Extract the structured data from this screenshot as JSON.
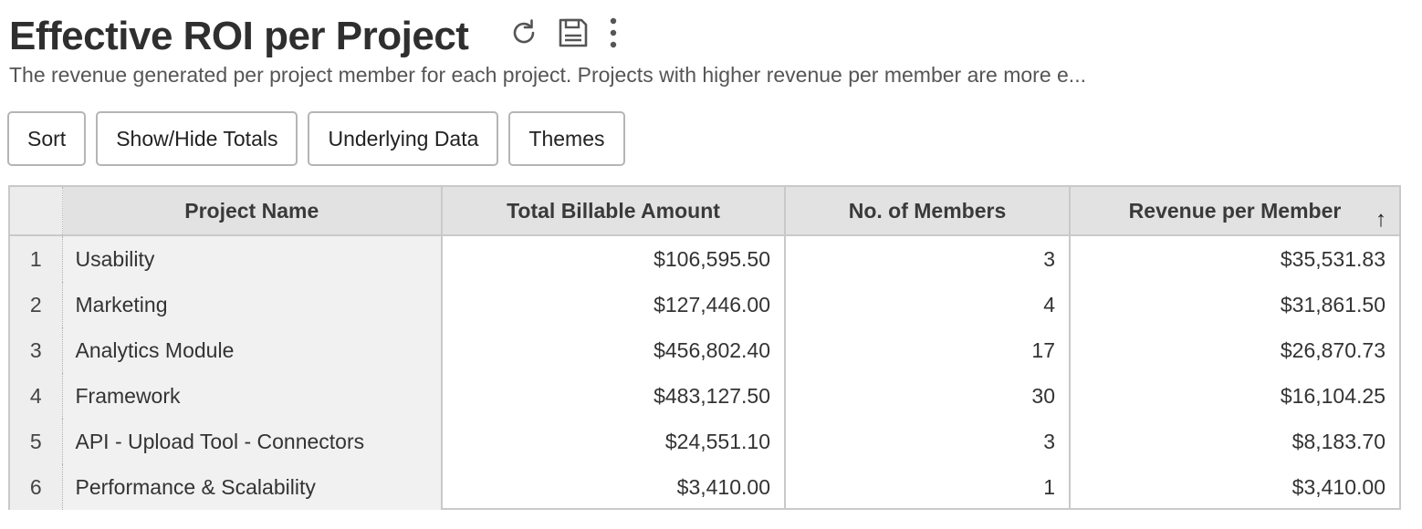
{
  "header": {
    "title": "Effective ROI per Project",
    "subtitle": "The revenue generated per project member for each project. Projects with higher revenue per member are more e...",
    "icons": [
      "refresh-icon",
      "save-icon",
      "more-vertical-icon"
    ]
  },
  "toolbar": {
    "sort_label": "Sort",
    "totals_label": "Show/Hide Totals",
    "underlying_label": "Underlying Data",
    "themes_label": "Themes"
  },
  "table": {
    "columns": [
      "Project Name",
      "Total Billable Amount",
      "No. of Members",
      "Revenue per Member"
    ],
    "sort_indicator": "↑",
    "rows": [
      {
        "index": "1",
        "project": "Usability",
        "billable": "$106,595.50",
        "members": "3",
        "revenue": "$35,531.83"
      },
      {
        "index": "2",
        "project": "Marketing",
        "billable": "$127,446.00",
        "members": "4",
        "revenue": "$31,861.50"
      },
      {
        "index": "3",
        "project": "Analytics Module",
        "billable": "$456,802.40",
        "members": "17",
        "revenue": "$26,870.73"
      },
      {
        "index": "4",
        "project": "Framework",
        "billable": "$483,127.50",
        "members": "30",
        "revenue": "$16,104.25"
      },
      {
        "index": "5",
        "project": "API - Upload Tool - Connectors",
        "billable": "$24,551.10",
        "members": "3",
        "revenue": "$8,183.70"
      },
      {
        "index": "6",
        "project": "Performance & Scalability",
        "billable": "$3,410.00",
        "members": "1",
        "revenue": "$3,410.00"
      }
    ]
  }
}
